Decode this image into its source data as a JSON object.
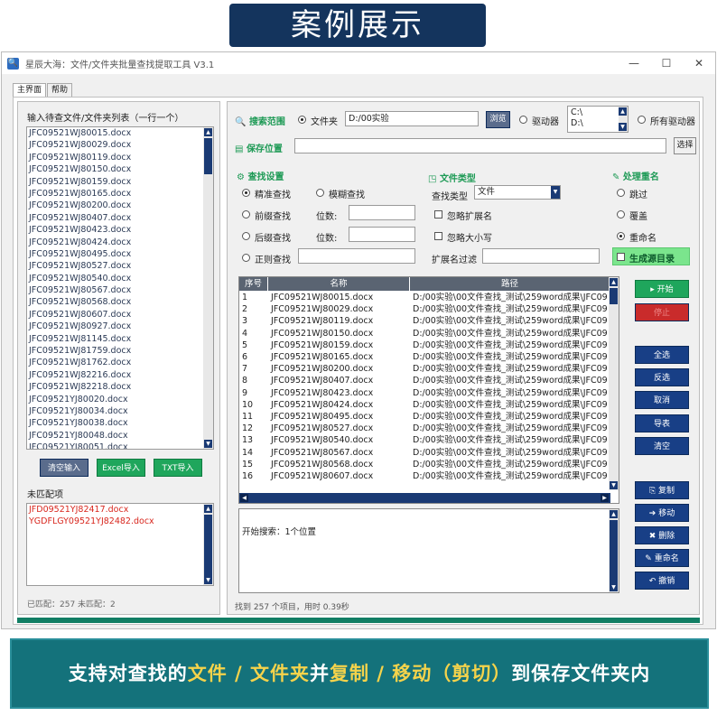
{
  "banner": {
    "title": "案例展示"
  },
  "window": {
    "title": "星辰大海：文件/文件夹批量查找提取工具 V3.1",
    "min": "—",
    "max": "☐",
    "close": "✕"
  },
  "tabs": [
    "主界面",
    "帮助"
  ],
  "left": {
    "list_label": "输入待查文件/文件夹列表（一行一个）",
    "files": [
      "JFC09521WJ80015.docx",
      "JFC09521WJ80029.docx",
      "JFC09521WJ80119.docx",
      "JFC09521WJ80150.docx",
      "JFC09521WJ80159.docx",
      "JFC09521WJ80165.docx",
      "JFC09521WJ80200.docx",
      "JFC09521WJ80407.docx",
      "JFC09521WJ80423.docx",
      "JFC09521WJ80424.docx",
      "JFC09521WJ80495.docx",
      "JFC09521WJ80527.docx",
      "JFC09521WJ80540.docx",
      "JFC09521WJ80567.docx",
      "JFC09521WJ80568.docx",
      "JFC09521WJ80607.docx",
      "JFC09521WJ80927.docx",
      "JFC09521WJ81145.docx",
      "JFC09521WJ81759.docx",
      "JFC09521WJ81762.docx",
      "JFC09521WJ82216.docx",
      "JFC09521WJ82218.docx",
      "JFC09521YJ80020.docx",
      "JFC09521YJ80034.docx",
      "JFC09521YJ80038.docx",
      "JFC09521YJ80048.docx",
      "JFC09521YJ80051.docx"
    ],
    "btn_clear": "清空输入",
    "btn_excel": "Excel导入",
    "btn_txt": "TXT导入",
    "unmatched_label": "未匹配项",
    "unmatched": [
      "JFD09521YJ82417.docx",
      "YGDFLGY09521YJ82482.docx"
    ],
    "status": "已匹配：257 未匹配：2"
  },
  "search": {
    "range_label": "搜索范围",
    "folder_label": "文件夹",
    "folder_value": "D:/00实验",
    "browse": "浏览",
    "drive_label": "驱动器",
    "drives": [
      "C:\\",
      "D:\\"
    ],
    "all_drives": "所有驱动器",
    "save_label": "保存位置",
    "save_value": "",
    "select": "选择"
  },
  "settings": {
    "title": "查找设置",
    "exact": "精准查找",
    "fuzzy": "模糊查找",
    "prefix": "前缀查找",
    "suffix": "后缀查找",
    "regex": "正则查找",
    "digits1": "位数:",
    "digits2": "位数:"
  },
  "filetype": {
    "title": "文件类型",
    "type_label": "查找类型",
    "type_value": "文件",
    "ignore_ext": "忽略扩展名",
    "ignore_case": "忽略大小写",
    "ext_filter": "扩展名过滤"
  },
  "rename": {
    "title": "处理重名",
    "skip": "跳过",
    "overwrite": "覆盖",
    "rename": "重命名",
    "gen_dir": "生成源目录"
  },
  "grid": {
    "headers": [
      "序号",
      "名称",
      "路径"
    ],
    "rows": [
      [
        "1",
        "JFC09521WJ80015.docx",
        "D:/00实验\\00文件查找_测试\\259word成果\\JFC09"
      ],
      [
        "2",
        "JFC09521WJ80029.docx",
        "D:/00实验\\00文件查找_测试\\259word成果\\JFC09"
      ],
      [
        "3",
        "JFC09521WJ80119.docx",
        "D:/00实验\\00文件查找_测试\\259word成果\\JFC09"
      ],
      [
        "4",
        "JFC09521WJ80150.docx",
        "D:/00实验\\00文件查找_测试\\259word成果\\JFC09"
      ],
      [
        "5",
        "JFC09521WJ80159.docx",
        "D:/00实验\\00文件查找_测试\\259word成果\\JFC09"
      ],
      [
        "6",
        "JFC09521WJ80165.docx",
        "D:/00实验\\00文件查找_测试\\259word成果\\JFC09"
      ],
      [
        "7",
        "JFC09521WJ80200.docx",
        "D:/00实验\\00文件查找_测试\\259word成果\\JFC09"
      ],
      [
        "8",
        "JFC09521WJ80407.docx",
        "D:/00实验\\00文件查找_测试\\259word成果\\JFC09"
      ],
      [
        "9",
        "JFC09521WJ80423.docx",
        "D:/00实验\\00文件查找_测试\\259word成果\\JFC09"
      ],
      [
        "10",
        "JFC09521WJ80424.docx",
        "D:/00实验\\00文件查找_测试\\259word成果\\JFC09"
      ],
      [
        "11",
        "JFC09521WJ80495.docx",
        "D:/00实验\\00文件查找_测试\\259word成果\\JFC09"
      ],
      [
        "12",
        "JFC09521WJ80527.docx",
        "D:/00实验\\00文件查找_测试\\259word成果\\JFC09"
      ],
      [
        "13",
        "JFC09521WJ80540.docx",
        "D:/00实验\\00文件查找_测试\\259word成果\\JFC09"
      ],
      [
        "14",
        "JFC09521WJ80567.docx",
        "D:/00实验\\00文件查找_测试\\259word成果\\JFC09"
      ],
      [
        "15",
        "JFC09521WJ80568.docx",
        "D:/00实验\\00文件查找_测试\\259word成果\\JFC09"
      ],
      [
        "16",
        "JFC09521WJ80607.docx",
        "D:/00实验\\00文件查找_测试\\259word成果\\JFC09"
      ]
    ]
  },
  "log": {
    "text": "开始搜索：1个位置"
  },
  "status": {
    "text": "找到 257 个项目，用时 0.39秒"
  },
  "actions": {
    "start": "▸ 开始",
    "stop": "停止",
    "select_all": "全选",
    "invert": "反选",
    "cancel": "取消",
    "export": "导表",
    "clear": "清空",
    "copy": "复制",
    "move": "移动",
    "delete": "删除",
    "rename": "重命名",
    "undo": "撤销"
  },
  "footer": {
    "p1": "支持对查找的",
    "h1": "文件",
    "p2": " / ",
    "h2": "文件夹",
    "p3": "并",
    "h3": "复制",
    "p4": " / ",
    "h4": "移动（剪切）",
    "p5": "到保存文件夹内"
  },
  "colors": {
    "navy": "#183f86",
    "green": "#1fa65c",
    "teal": "#14727b",
    "highlight": "#f5d34b"
  }
}
